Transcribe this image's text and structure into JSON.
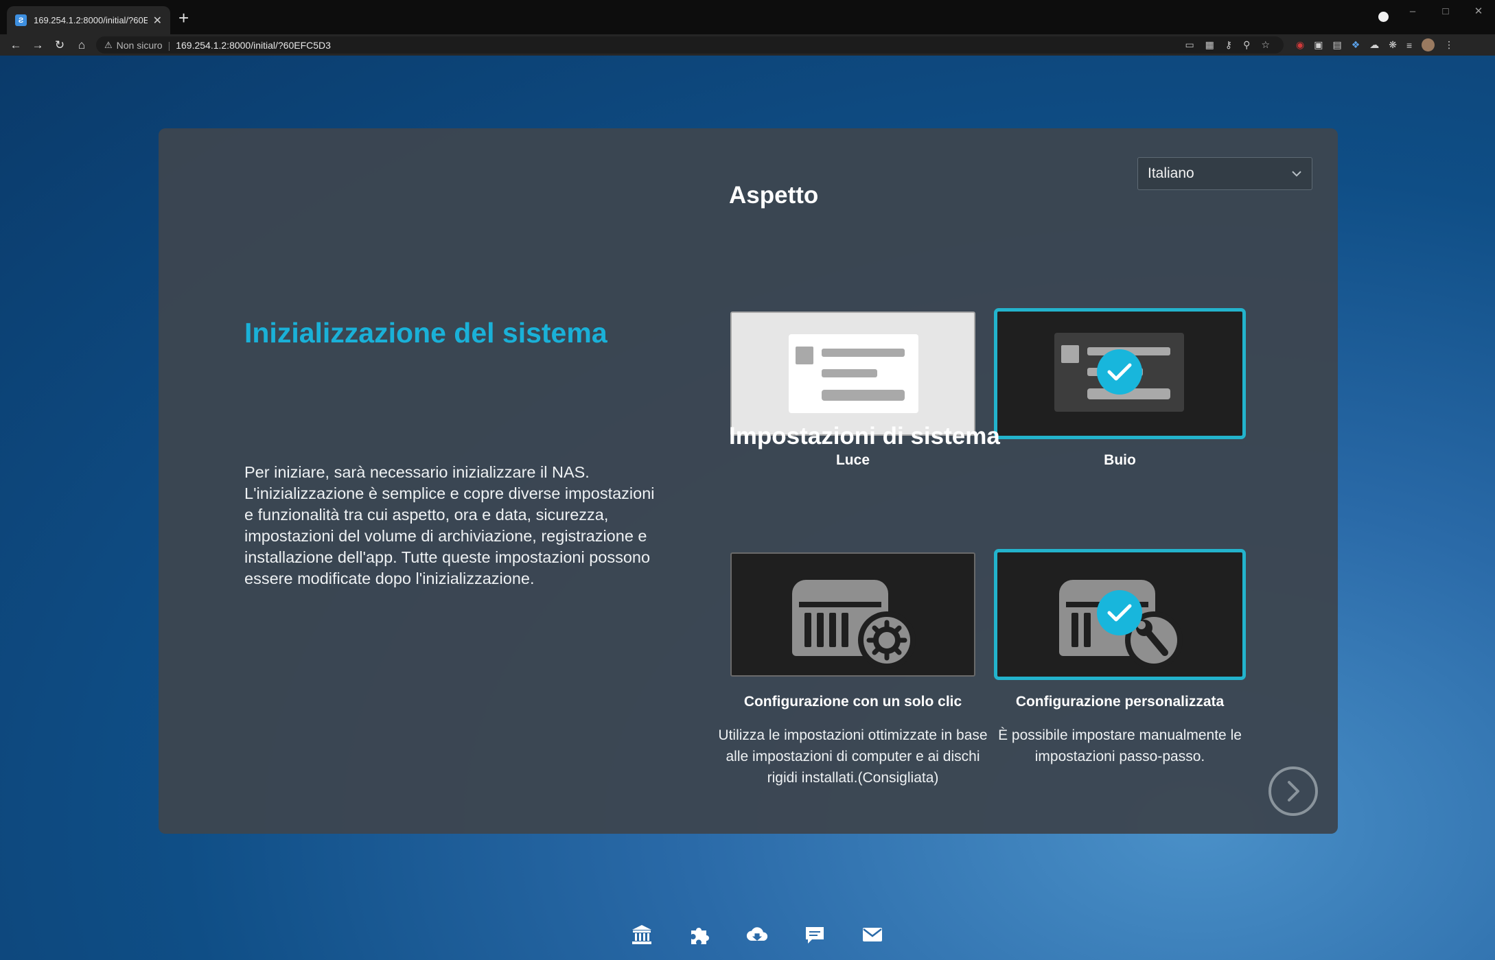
{
  "browser": {
    "tab_title": "169.254.1.2:8000/initial/?60EFC5D3",
    "tab_close": "✕",
    "new_tab": "+",
    "not_secure": "Non sicuro",
    "url": "169.254.1.2:8000/initial/?60EFC5D3"
  },
  "language": {
    "selected": "Italiano"
  },
  "intro": {
    "title": "Inizializzazione del sistema",
    "body": "Per iniziare, sarà necessario inizializzare il NAS. L'inizializzazione è semplice e copre diverse impostazioni e funzionalità tra cui aspetto, ora e data, sicurezza, impostazioni del volume di archiviazione, registrazione e installazione dell'app. Tutte queste impostazioni possono essere modificate dopo l'inizializzazione."
  },
  "appearance": {
    "title": "Aspetto",
    "options": [
      {
        "label": "Luce",
        "selected": false
      },
      {
        "label": "Buio",
        "selected": true
      }
    ]
  },
  "system_settings": {
    "title": "Impostazioni di sistema",
    "options": [
      {
        "label": "Configurazione con un solo clic",
        "desc": "Utilizza le impostazioni ottimizzate in base alle impostazioni di computer e ai dischi rigidi installati.(Consigliata)",
        "selected": false
      },
      {
        "label": "Configurazione personalizzata",
        "desc": "È possibile impostare manualmente le impostazioni passo-passo.",
        "selected": true
      }
    ]
  },
  "colors": {
    "accent": "#1ab1d8",
    "card": "#3c4650",
    "selected_border": "#23b3cc"
  },
  "dock_icons": [
    "bank-icon",
    "puzzle-icon",
    "cloud-download-icon",
    "chat-icon",
    "mail-icon"
  ]
}
